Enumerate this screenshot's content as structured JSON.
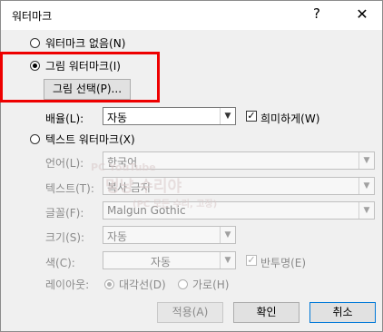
{
  "dialog": {
    "title": "워터마크",
    "help_glyph": "?",
    "close_glyph": "✕"
  },
  "options": {
    "none_label": "워터마크 없음(N)",
    "picture_label": "그림 워터마크(I)",
    "select_picture_button": "그림 선택(P)...",
    "scale_label": "배율(L):",
    "scale_value": "자동",
    "washout_label": "희미하게(W)",
    "text_label": "텍스트 워터마크(X)"
  },
  "text_watermark": {
    "language_label": "언어(L):",
    "language_value": "한국어",
    "text_label": "텍스트(T):",
    "text_value": "복사 금지",
    "font_label": "글꼴(F):",
    "font_value": "Malgun Gothic",
    "size_label": "크기(S):",
    "size_value": "자동",
    "color_label": "색(C):",
    "color_value": "자동",
    "semitransparent_label": "반투명(E)",
    "layout_label": "레이아웃:",
    "diagonal_label": "대각선(D)",
    "horizontal_label": "가로(H)"
  },
  "buttons": {
    "apply": "적용(A)",
    "ok": "확인",
    "cancel": "취소"
  },
  "overlay": {
    "watermark_line1": "PC YouTube",
    "watermark_line2": "멍냥 수리야",
    "watermark_line3": "(PC 모든 수리, 고장)"
  },
  "colors": {
    "highlight": "#ee0000",
    "dialog_bg": "#f0f0f0"
  },
  "state": {
    "selected_option": "picture",
    "washout_checked": true,
    "semitransparent_checked": true,
    "diagonal_selected": true
  }
}
